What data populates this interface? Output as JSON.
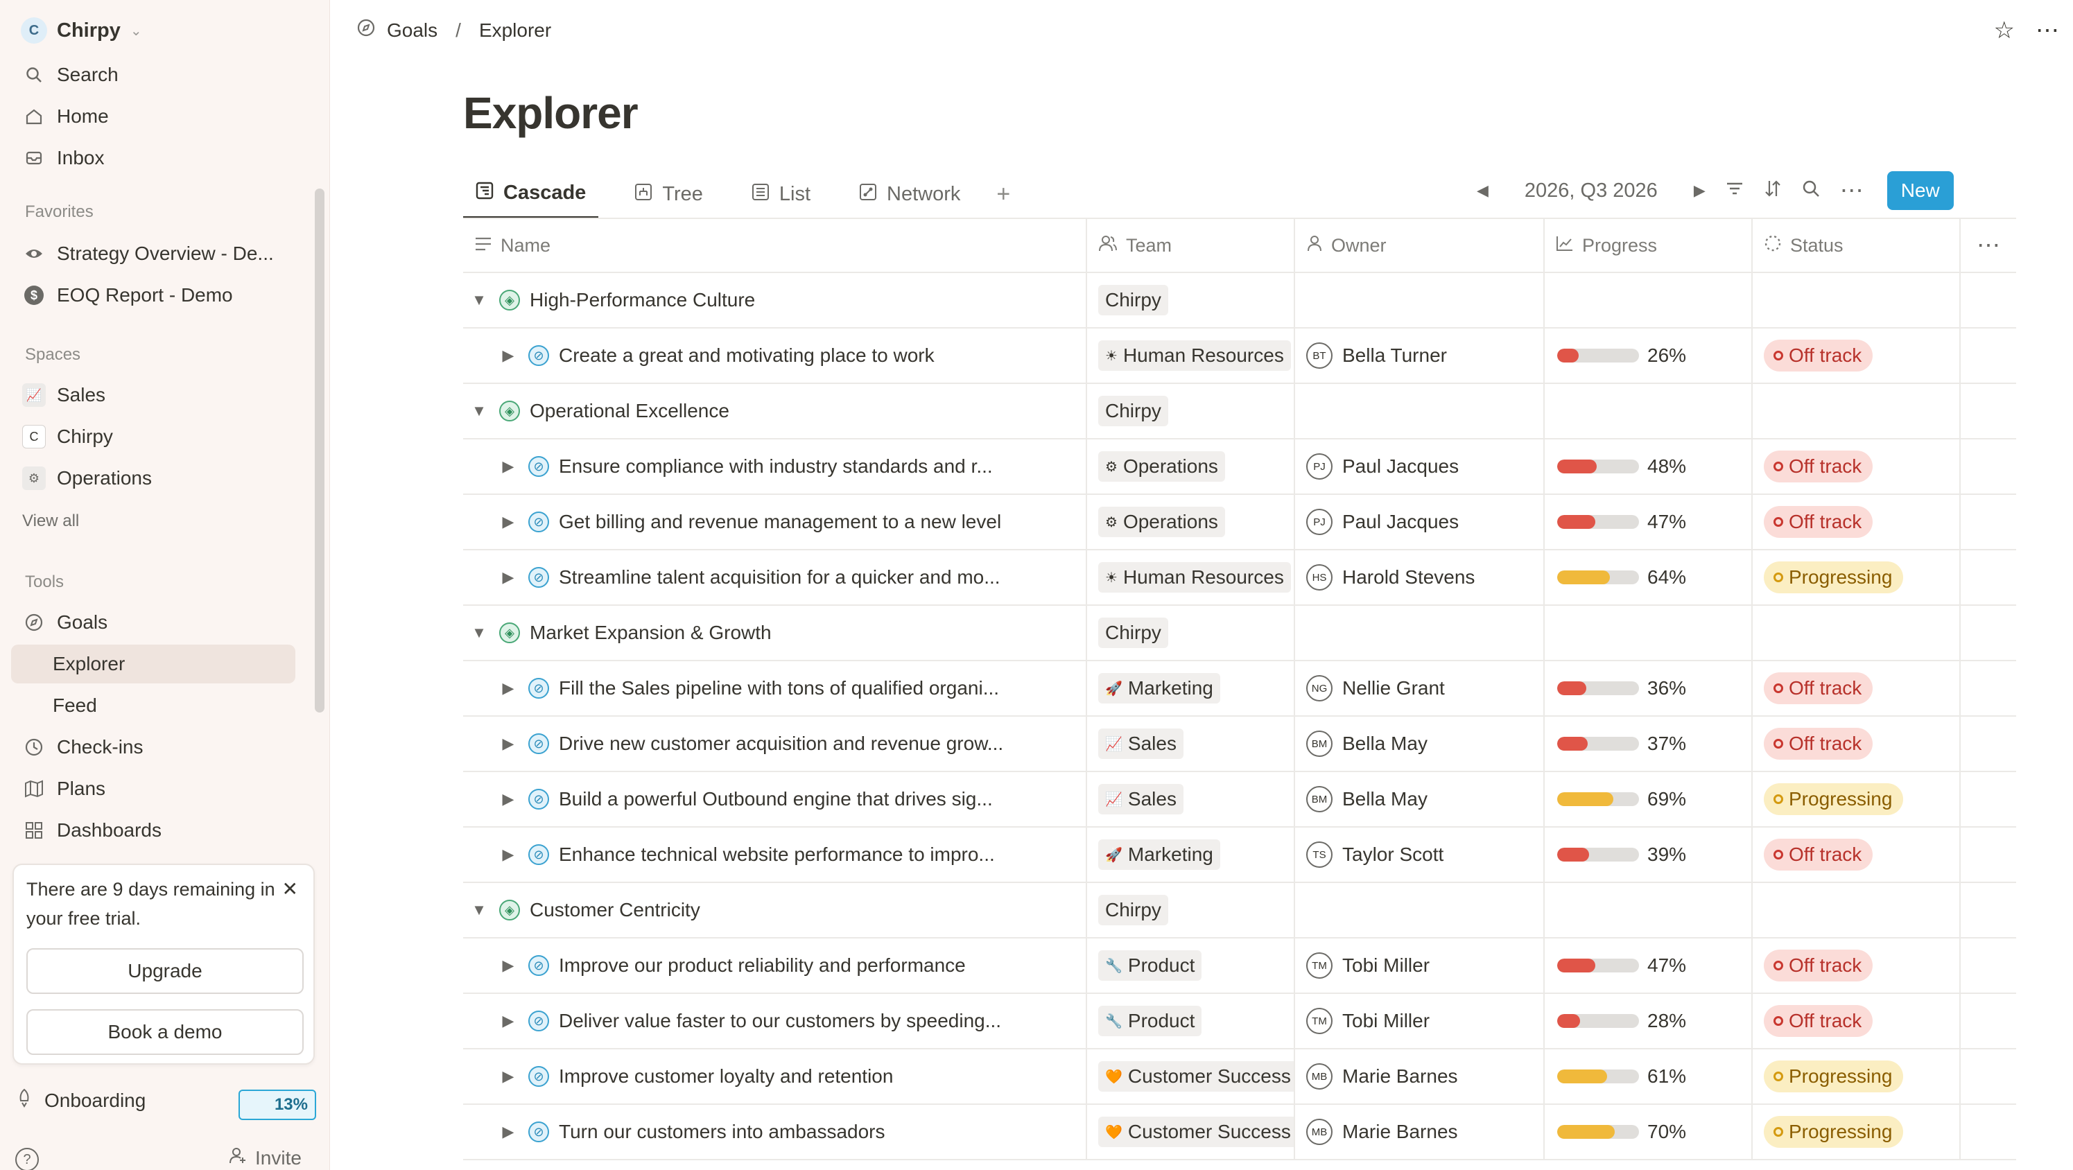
{
  "workspace": {
    "initial": "C",
    "name": "Chirpy"
  },
  "sidebar": {
    "top_items": [
      {
        "label": "Search",
        "icon": "search-icon"
      },
      {
        "label": "Home",
        "icon": "home-icon"
      },
      {
        "label": "Inbox",
        "icon": "inbox-icon"
      }
    ],
    "favorites_title": "Favorites",
    "favorites": [
      {
        "label": "Strategy Overview - De...",
        "icon": "eye-icon"
      },
      {
        "label": "EOQ Report - Demo",
        "icon": "dollar-icon"
      }
    ],
    "spaces_title": "Spaces",
    "spaces": [
      {
        "label": "Sales",
        "icon": "chart-icon"
      },
      {
        "label": "Chirpy",
        "icon": "c-icon"
      },
      {
        "label": "Operations",
        "icon": "gear-icon"
      }
    ],
    "view_all": "View all",
    "tools_title": "Tools",
    "tools": [
      {
        "label": "Goals",
        "icon": "goal-icon"
      },
      {
        "label": "Explorer",
        "icon": ""
      },
      {
        "label": "Feed",
        "icon": ""
      },
      {
        "label": "Check-ins",
        "icon": "clock-icon"
      },
      {
        "label": "Plans",
        "icon": "map-icon"
      },
      {
        "label": "Dashboards",
        "icon": "grid-icon"
      }
    ],
    "trial": {
      "text": "There are 9 days remaining in your free trial.",
      "upgrade": "Upgrade",
      "book_demo": "Book a demo"
    },
    "onboarding": {
      "label": "Onboarding",
      "progress": "13%"
    },
    "invite": "Invite"
  },
  "breadcrumb": {
    "parent": "Goals",
    "current": "Explorer"
  },
  "page": {
    "title": "Explorer"
  },
  "tabs": [
    {
      "label": "Cascade",
      "active": true
    },
    {
      "label": "Tree",
      "active": false
    },
    {
      "label": "List",
      "active": false
    },
    {
      "label": "Network",
      "active": false
    }
  ],
  "toolbar": {
    "period": "2026, Q3 2026",
    "new_label": "New"
  },
  "columns": {
    "name": "Name",
    "team": "Team",
    "owner": "Owner",
    "progress": "Progress",
    "status": "Status"
  },
  "colors": {
    "off_track": "#e05548",
    "progressing": "#f0b93b",
    "accent": "#2a9fd6"
  },
  "rows": [
    {
      "level": 0,
      "name": "High-Performance Culture",
      "team": "Chirpy",
      "team_icon": ""
    },
    {
      "level": 1,
      "name": "Create a great and motivating place to work",
      "team": "Human Resources",
      "team_icon": "☀",
      "owner_initials": "BT",
      "owner": "Bella Turner",
      "progress": 26,
      "progress_label": "26%",
      "status": "Off track"
    },
    {
      "level": 0,
      "name": "Operational Excellence",
      "team": "Chirpy",
      "team_icon": ""
    },
    {
      "level": 1,
      "name": "Ensure compliance with industry standards and r...",
      "team": "Operations",
      "team_icon": "⚙",
      "owner_initials": "PJ",
      "owner": "Paul Jacques",
      "progress": 48,
      "progress_label": "48%",
      "status": "Off track"
    },
    {
      "level": 1,
      "name": "Get billing and revenue management to a new level",
      "team": "Operations",
      "team_icon": "⚙",
      "owner_initials": "PJ",
      "owner": "Paul Jacques",
      "progress": 47,
      "progress_label": "47%",
      "status": "Off track"
    },
    {
      "level": 1,
      "name": "Streamline talent acquisition for a quicker and mo...",
      "team": "Human Resources",
      "team_icon": "☀",
      "owner_initials": "HS",
      "owner": "Harold Stevens",
      "progress": 64,
      "progress_label": "64%",
      "status": "Progressing"
    },
    {
      "level": 0,
      "name": "Market Expansion & Growth",
      "team": "Chirpy",
      "team_icon": ""
    },
    {
      "level": 1,
      "name": "Fill the Sales pipeline with tons of qualified organi...",
      "team": "Marketing",
      "team_icon": "🚀",
      "owner_initials": "NG",
      "owner": "Nellie Grant",
      "progress": 36,
      "progress_label": "36%",
      "status": "Off track"
    },
    {
      "level": 1,
      "name": "Drive new customer acquisition and revenue grow...",
      "team": "Sales",
      "team_icon": "📈",
      "owner_initials": "BM",
      "owner": "Bella May",
      "progress": 37,
      "progress_label": "37%",
      "status": "Off track"
    },
    {
      "level": 1,
      "name": "Build a powerful Outbound engine that drives sig...",
      "team": "Sales",
      "team_icon": "📈",
      "owner_initials": "BM",
      "owner": "Bella May",
      "progress": 69,
      "progress_label": "69%",
      "status": "Progressing"
    },
    {
      "level": 1,
      "name": "Enhance technical website performance to impro...",
      "team": "Marketing",
      "team_icon": "🚀",
      "owner_initials": "TS",
      "owner": "Taylor Scott",
      "progress": 39,
      "progress_label": "39%",
      "status": "Off track"
    },
    {
      "level": 0,
      "name": "Customer Centricity",
      "team": "Chirpy",
      "team_icon": ""
    },
    {
      "level": 1,
      "name": "Improve our product reliability and performance",
      "team": "Product",
      "team_icon": "🔧",
      "owner_initials": "TM",
      "owner": "Tobi Miller",
      "progress": 47,
      "progress_label": "47%",
      "status": "Off track"
    },
    {
      "level": 1,
      "name": "Deliver value faster to our customers by speeding...",
      "team": "Product",
      "team_icon": "🔧",
      "owner_initials": "TM",
      "owner": "Tobi Miller",
      "progress": 28,
      "progress_label": "28%",
      "status": "Off track"
    },
    {
      "level": 1,
      "name": "Improve customer loyalty and retention",
      "team": "Customer Success",
      "team_icon": "🧡",
      "owner_initials": "MB",
      "owner": "Marie Barnes",
      "progress": 61,
      "progress_label": "61%",
      "status": "Progressing"
    },
    {
      "level": 1,
      "name": "Turn our customers into ambassadors",
      "team": "Customer Success",
      "team_icon": "🧡",
      "owner_initials": "MB",
      "owner": "Marie Barnes",
      "progress": 70,
      "progress_label": "70%",
      "status": "Progressing"
    }
  ]
}
